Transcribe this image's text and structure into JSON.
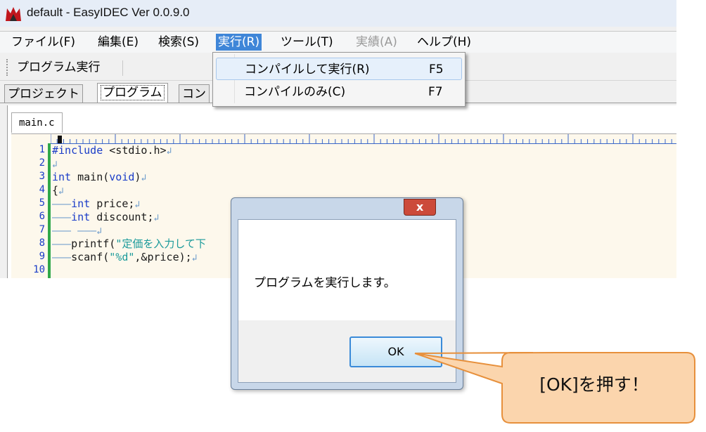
{
  "window": {
    "title": "default - EasyIDEC Ver 0.0.9.0"
  },
  "menubar": {
    "items": [
      {
        "label": "ファイル(F)"
      },
      {
        "label": "編集(E)"
      },
      {
        "label": "検索(S)"
      },
      {
        "label": "実行(R)"
      },
      {
        "label": "ツール(T)"
      },
      {
        "label": "実績(A)"
      },
      {
        "label": "ヘルプ(H)"
      }
    ]
  },
  "toolbar": {
    "run_label": "プログラム実行"
  },
  "tabs": [
    {
      "label": "プロジェクト"
    },
    {
      "label": "プログラム"
    },
    {
      "label": "コン"
    }
  ],
  "document": {
    "tab_label": "main.c"
  },
  "editor": {
    "line_numbers": [
      "1",
      "2",
      "3",
      "4",
      "5",
      "6",
      "7",
      "8",
      "9",
      "10"
    ]
  },
  "run_menu": {
    "items": [
      {
        "label": "コンパイルして実行(R)",
        "shortcut": "F5"
      },
      {
        "label": "コンパイルのみ(C)",
        "shortcut": "F7"
      }
    ]
  },
  "dialog": {
    "message": "プログラムを実行します。",
    "ok_label": "OK",
    "close_label": "x"
  },
  "callout": {
    "text": "[OK]を押す！"
  },
  "colors": {
    "menu_open": "#3f86d8",
    "callout_fill": "#fbd5ad",
    "callout_border": "#e7903c",
    "gutter_border": "#31a84a",
    "keyword": "#1a3cc8",
    "string": "#1a9a9a"
  }
}
